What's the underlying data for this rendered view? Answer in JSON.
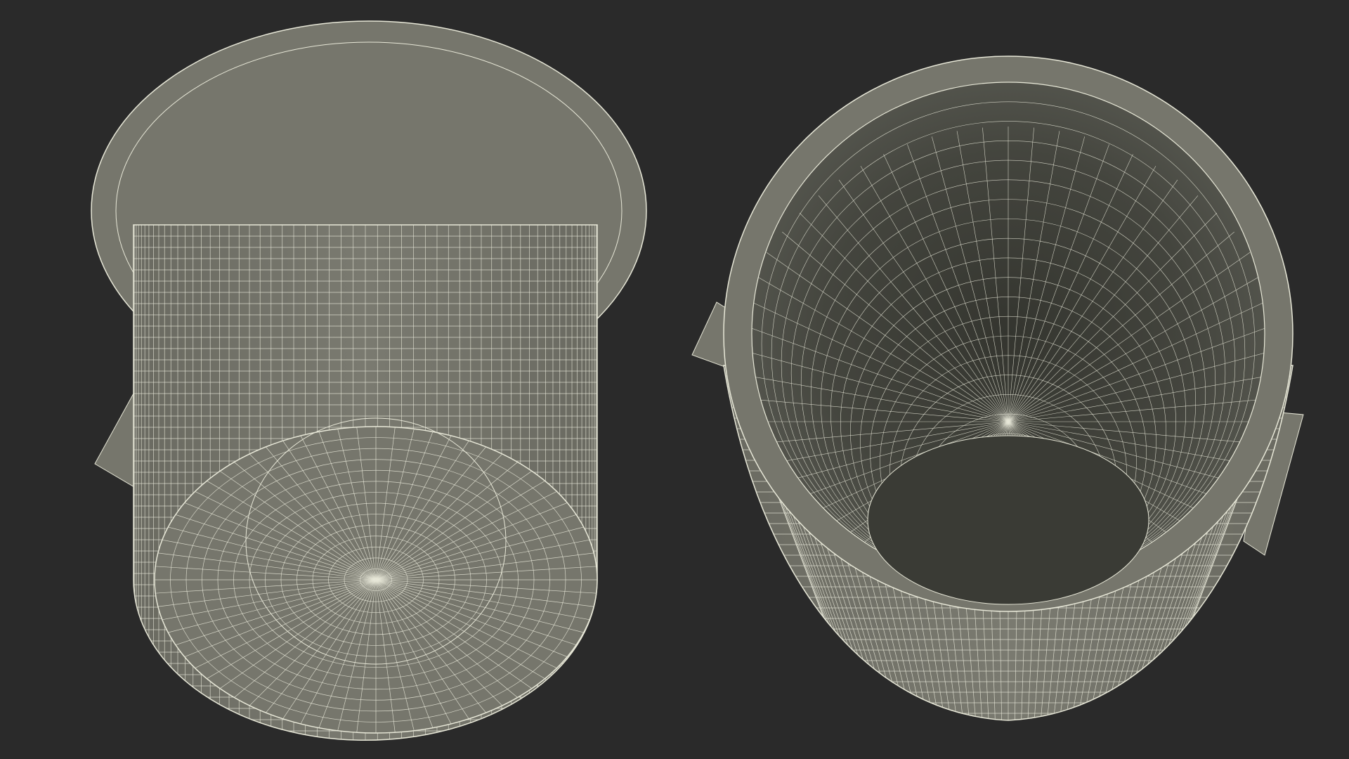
{
  "scene": {
    "background_color": "#2a2a2a",
    "mesh_fill_color": "#76766c",
    "mesh_fill_dark": "#4e4f48",
    "mesh_fill_deep": "#3e3f39",
    "wire_color": "#e8e8d8",
    "objects": [
      {
        "name": "trash-can-bottom-view",
        "view": "bottom"
      },
      {
        "name": "trash-can-top-view",
        "view": "top"
      }
    ]
  }
}
